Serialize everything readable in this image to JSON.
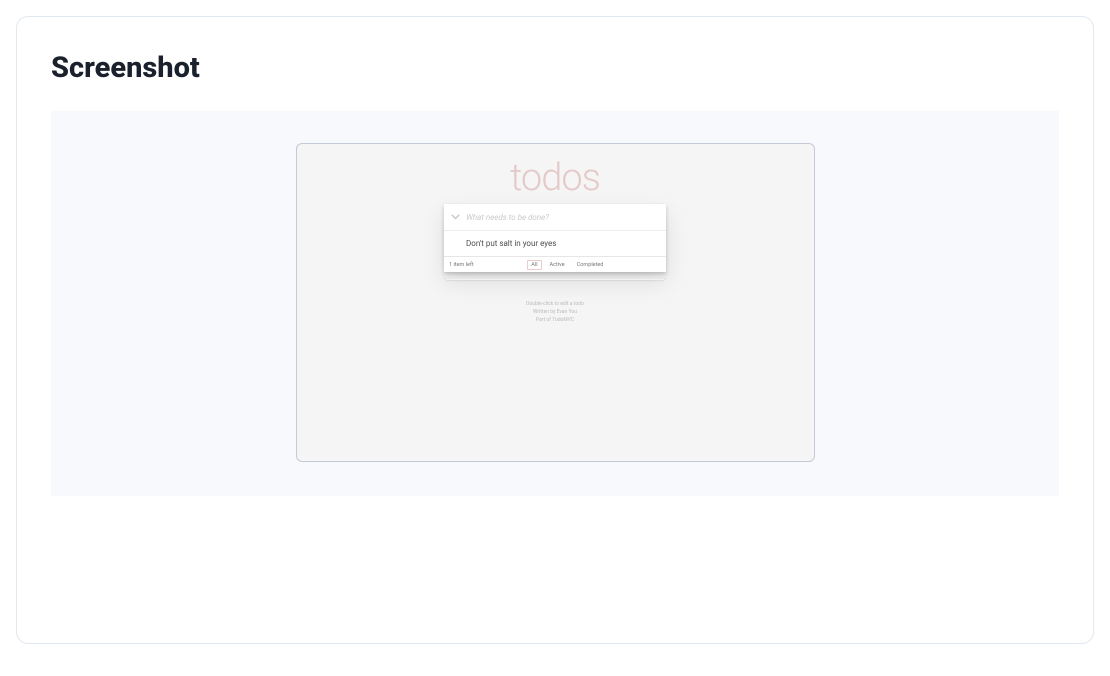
{
  "page": {
    "heading": "Screenshot"
  },
  "todoapp": {
    "title": "todos",
    "placeholder": "What needs to be done?",
    "items": [
      {
        "text": "Don't put salt in your eyes",
        "completed": false
      }
    ],
    "footer": {
      "count_text": "1 item left",
      "filters": {
        "all": "All",
        "active": "Active",
        "completed": "Completed"
      },
      "selected_filter": "all"
    },
    "info": {
      "line1": "Double-click to edit a todo",
      "line2": "Written by Evan You",
      "line3": "Part of TodoMVC"
    }
  }
}
